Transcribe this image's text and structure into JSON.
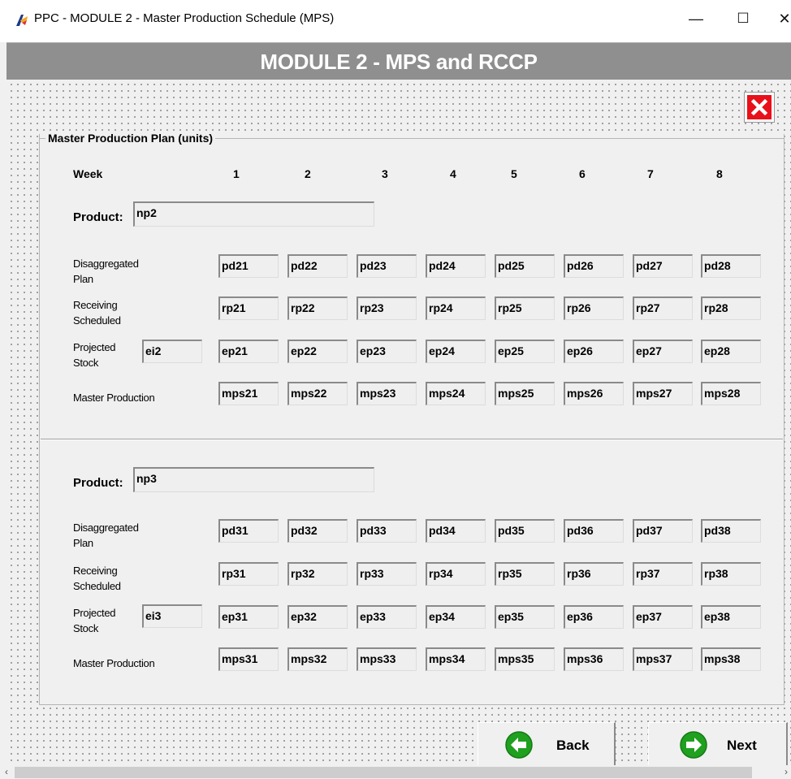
{
  "window": {
    "title": "PPC - MODULE 2 - Master Production Schedule (MPS)",
    "minimize_glyph": "—",
    "maximize_glyph": "☐",
    "close_glyph": "✕"
  },
  "header": {
    "title": "MODULE 2 - MPS and RCCP"
  },
  "panel": {
    "legend": "Master Production Plan (units)",
    "week_label": "Week",
    "weeks": [
      "1",
      "2",
      "3",
      "4",
      "5",
      "6",
      "7",
      "8"
    ],
    "product_label": "Product:",
    "row_labels": {
      "disaggregated_line1": "Disaggregated",
      "disaggregated_line2": "Plan",
      "receiving_line1": "Receiving",
      "receiving_line2": "Scheduled",
      "projected_line1": "Projected",
      "projected_line2": "Stock",
      "master": "Master Production"
    },
    "products": [
      {
        "name": "np2",
        "initial_stock": "ei2",
        "disaggregated": [
          "pd21",
          "pd22",
          "pd23",
          "pd24",
          "pd25",
          "pd26",
          "pd27",
          "pd28"
        ],
        "receiving": [
          "rp21",
          "rp22",
          "rp23",
          "rp24",
          "rp25",
          "rp26",
          "rp27",
          "rp28"
        ],
        "projected": [
          "ep21",
          "ep22",
          "ep23",
          "ep24",
          "ep25",
          "ep26",
          "ep27",
          "ep28"
        ],
        "master": [
          "mps21",
          "mps22",
          "mps23",
          "mps24",
          "mps25",
          "mps26",
          "mps27",
          "mps28"
        ]
      },
      {
        "name": "np3",
        "initial_stock": "ei3",
        "disaggregated": [
          "pd31",
          "pd32",
          "pd33",
          "pd34",
          "pd35",
          "pd36",
          "pd37",
          "pd38"
        ],
        "receiving": [
          "rp31",
          "rp32",
          "rp33",
          "rp34",
          "rp35",
          "rp36",
          "rp37",
          "rp38"
        ],
        "projected": [
          "ep31",
          "ep32",
          "ep33",
          "ep34",
          "ep35",
          "ep36",
          "ep37",
          "ep38"
        ],
        "master": [
          "mps31",
          "mps32",
          "mps33",
          "mps34",
          "mps35",
          "mps36",
          "mps37",
          "mps38"
        ]
      }
    ]
  },
  "nav": {
    "back_label": "Back",
    "next_label": "Next"
  },
  "icons": {
    "app": "app-logo-icon",
    "close_form": "close-x-icon",
    "back": "arrow-left-icon",
    "next": "arrow-right-icon",
    "scroll_left": "chevron-left-icon",
    "scroll_right": "chevron-right-icon"
  },
  "colors": {
    "header_band": "#8f8f8f",
    "close_button": "#e8101a",
    "nav_arrow": "#1fa01f"
  }
}
